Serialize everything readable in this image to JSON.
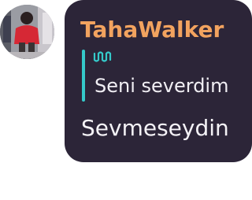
{
  "message": {
    "sender_name": "TahaWalker",
    "sender_color": "#f2a35f",
    "reply": {
      "icon": "audio-wave-icon",
      "accent_color": "#35c9c9",
      "quoted_text": "Seni severdim"
    },
    "text": "Sevmeseydin",
    "bubble_color": "#2c2538"
  },
  "avatar": {
    "icon": "user-avatar"
  }
}
